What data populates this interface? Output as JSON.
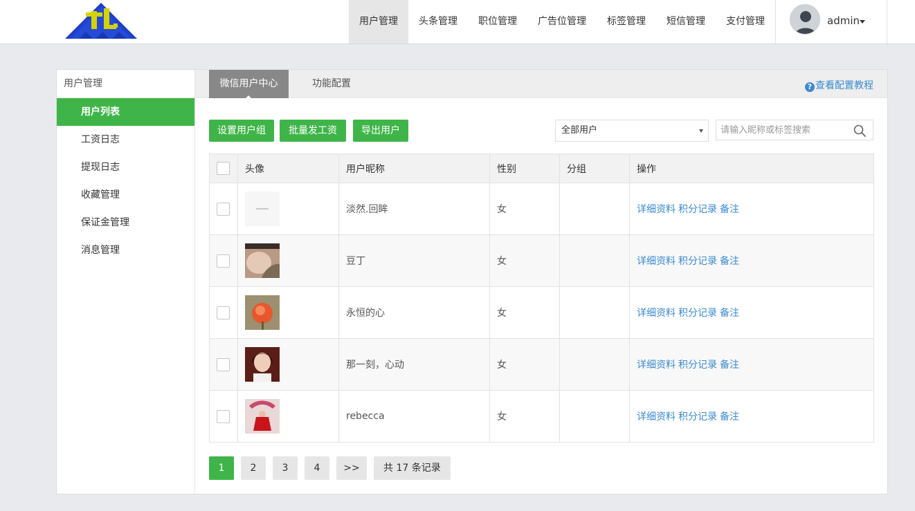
{
  "header": {
    "nav": [
      "用户管理",
      "头条管理",
      "职位管理",
      "广告位管理",
      "标签管理",
      "短信管理",
      "支付管理"
    ],
    "active_nav": 0,
    "username": "admin"
  },
  "sidebar": {
    "title": "用户管理",
    "items": [
      "用户列表",
      "工资日志",
      "提现日志",
      "收藏管理",
      "保证金管理",
      "消息管理"
    ],
    "active": 0
  },
  "tabs": [
    "微信用户中心",
    "功能配置"
  ],
  "tutorial_link": "查看配置教程",
  "toolbar": {
    "set_group": "设置用户组",
    "batch_pay": "批量发工资",
    "export": "导出用户",
    "filter_value": "全部用户",
    "search_placeholder": "请输入昵称或标签搜索"
  },
  "table": {
    "headers": [
      "头像",
      "用户昵称",
      "性别",
      "分组",
      "操作"
    ],
    "rows": [
      {
        "nickname": "淡然.回眸",
        "gender": "女",
        "group": ""
      },
      {
        "nickname": "豆丁",
        "gender": "女",
        "group": ""
      },
      {
        "nickname": "永恒的心",
        "gender": "女",
        "group": ""
      },
      {
        "nickname": "那一刻，心动",
        "gender": "女",
        "group": ""
      },
      {
        "nickname": "rebecca",
        "gender": "女",
        "group": ""
      }
    ],
    "actions": [
      "详细资料",
      "积分记录",
      "备注"
    ]
  },
  "pager": {
    "pages": [
      "1",
      "2",
      "3",
      "4"
    ],
    "next": ">>",
    "total": "共 17 条记录"
  },
  "colors": {
    "accent": "#3fb549",
    "link": "#3a8ad0"
  }
}
